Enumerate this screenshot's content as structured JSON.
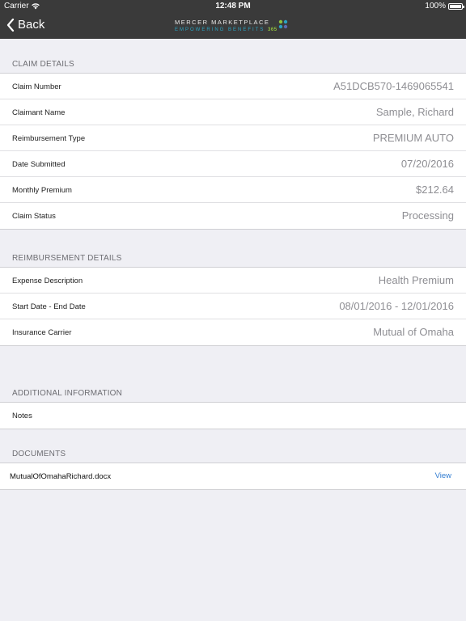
{
  "status_bar": {
    "carrier": "Carrier",
    "time": "12:48 PM",
    "battery": "100%",
    "battery_level": 1.0
  },
  "nav": {
    "back_label": "Back",
    "logo_line1": "MERCER MARKETPLACE",
    "logo_line2": "EMPOWERING BENEFITS",
    "logo_number": "365"
  },
  "claim_details": {
    "header": "CLAIM DETAILS",
    "rows": [
      {
        "label": "Claim Number",
        "value": "A51DCB570-1469065541"
      },
      {
        "label": "Claimant Name",
        "value": "Sample, Richard"
      },
      {
        "label": "Reimbursement Type",
        "value": "PREMIUM AUTO"
      },
      {
        "label": "Date Submitted",
        "value": "07/20/2016"
      },
      {
        "label": "Monthly Premium",
        "value": "$212.64"
      },
      {
        "label": "Claim Status",
        "value": "Processing"
      }
    ]
  },
  "reimbursement_details": {
    "header": "REIMBURSEMENT DETAILS",
    "rows": [
      {
        "label": "Expense Description",
        "value": "Health Premium"
      },
      {
        "label": "Start Date - End Date",
        "value": "08/01/2016 - 12/01/2016"
      },
      {
        "label": "Insurance Carrier",
        "value": "Mutual of Omaha"
      }
    ]
  },
  "additional_information": {
    "header": "ADDITIONAL INFORMATION",
    "notes_label": "Notes"
  },
  "documents": {
    "header": "DOCUMENTS",
    "items": [
      {
        "filename": "MutualOfOmahaRichard.docx",
        "action": "View"
      }
    ]
  },
  "colors": {
    "bar": "#3a3a3a",
    "background": "#efeff4",
    "link": "#2f7bd1",
    "value_text": "#8e8e93"
  }
}
